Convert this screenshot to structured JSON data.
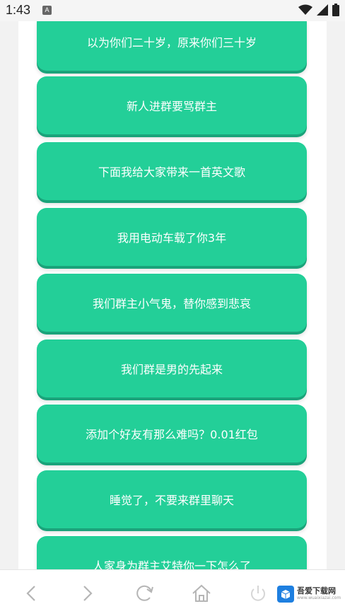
{
  "status": {
    "time": "1:43",
    "app_icon_glyph": "A"
  },
  "buttons": [
    "以为你们二十岁，原来你们三十岁",
    "新人进群要骂群主",
    "下面我给大家带来一首英文歌",
    "我用电动车载了你3年",
    "我们群主小气鬼，替你感到悲哀",
    "我们群是男的先起来",
    "添加个好友有那么难吗？0.01红包",
    "睡觉了，不要来群里聊天",
    "人家身为群主艾特你一下怎么了"
  ],
  "bottom_nav": {
    "icons": [
      "back-icon",
      "forward-icon",
      "refresh-icon",
      "home-icon",
      "power-icon"
    ]
  },
  "watermark": {
    "title": "吾爱下载网",
    "subtitle": "www.wuaixiazai.com"
  },
  "colors": {
    "button_green": "#23cf98",
    "button_shadow": "#1aa37a",
    "brand_blue": "#1e7fe0"
  }
}
